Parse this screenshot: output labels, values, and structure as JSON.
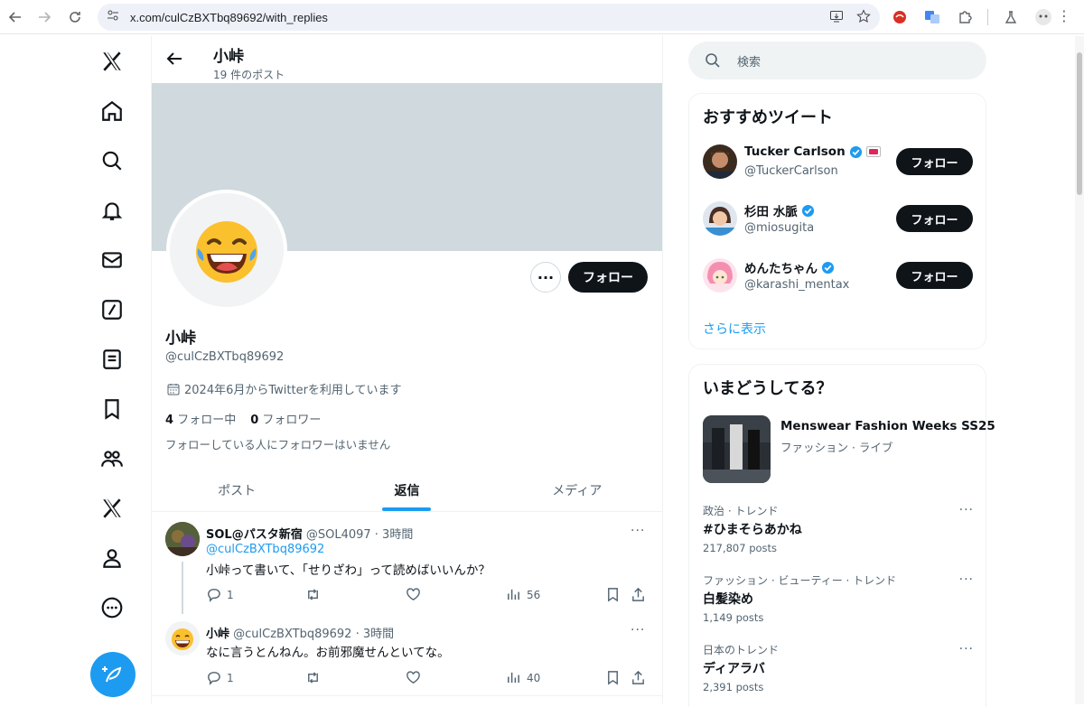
{
  "browser": {
    "url": "x.com/culCzBXTbq89692/with_replies"
  },
  "profile_header": {
    "title": "小峠",
    "post_count": "19 件のポスト"
  },
  "profile": {
    "name": "小峠",
    "handle": "@culCzBXTbq89692",
    "joined": "2024年6月からTwitterを利用しています",
    "following_count": "4",
    "following_label": "フォロー中",
    "followers_count": "0",
    "followers_label": "フォロワー",
    "mutual_note": "フォローしている人にフォロワーはいません",
    "follow_label": "フォロー",
    "more_label": "···"
  },
  "tabs": [
    {
      "label": "ポスト",
      "active": false
    },
    {
      "label": "返信",
      "active": true
    },
    {
      "label": "メディア",
      "active": false
    }
  ],
  "tweets": [
    {
      "name": "SOL@パスタ新宿",
      "meta": "@SOL4097 · 3時間",
      "reply_to": "@culCzBXTbq89692",
      "text": "小峠って書いて、「せりざわ」って読めばいいんか？",
      "replies": "1",
      "retweets": "",
      "likes": "",
      "views": "56"
    },
    {
      "name": "小峠",
      "meta": "@culCzBXTbq89692 · 3時間",
      "reply_to": "",
      "text": "なに言うとんねん。お前邪魔せんといてな。",
      "replies": "1",
      "retweets": "",
      "likes": "",
      "views": "40"
    }
  ],
  "search": {
    "placeholder": "検索"
  },
  "recommend": {
    "title": "おすすめツイート",
    "show_more": "さらに表示",
    "users": [
      {
        "name": "Tucker Carlson",
        "handle": "@TuckerCarlson",
        "button": "フォロー"
      },
      {
        "name": "杉田 水脈",
        "handle": "@miosugita",
        "button": "フォロー"
      },
      {
        "name": "めんたちゃん",
        "handle": "@karashi_mentax",
        "button": "フォロー"
      }
    ]
  },
  "trends": {
    "title": "いまどうしてる？",
    "featured": {
      "name": "Menswear Fashion Weeks SS25",
      "category": "ファッション · ライブ"
    },
    "items": [
      {
        "category": "政治 · トレンド",
        "name": "#ひまそらあかね",
        "count": "217,807 posts"
      },
      {
        "category": "ファッション · ビューティー · トレンド",
        "name": "白髪染め",
        "count": "1,149 posts"
      },
      {
        "category": "日本のトレンド",
        "name": "ディアラバ",
        "count": "2,391 posts"
      }
    ],
    "more_label": "···"
  },
  "colors": {
    "accent": "#1d9bf0",
    "dark": "#0f1419",
    "muted": "#536471",
    "banner": "#cfd9de"
  }
}
